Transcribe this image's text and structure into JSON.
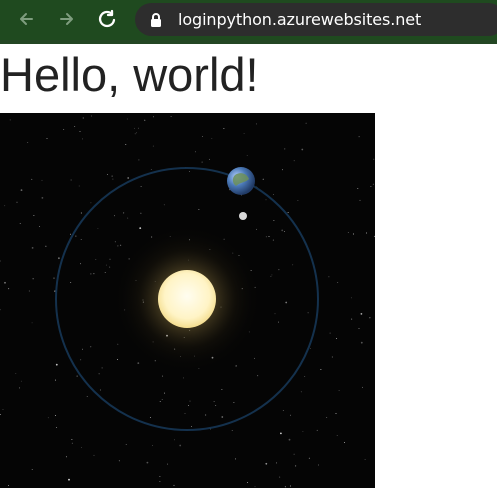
{
  "browser": {
    "url": "loginpython.azurewebsites.net",
    "back_icon": "back-arrow-icon",
    "forward_icon": "forward-arrow-icon",
    "reload_icon": "reload-icon",
    "secure_icon": "lock-icon"
  },
  "page": {
    "title": "Hello, world!"
  },
  "scene": {
    "background_color": "#050505",
    "sun_color": "#fff4c6",
    "orbit_color": "#14314d",
    "earth_color": "#3f6aa2",
    "moon_color": "#d9d9d9"
  }
}
